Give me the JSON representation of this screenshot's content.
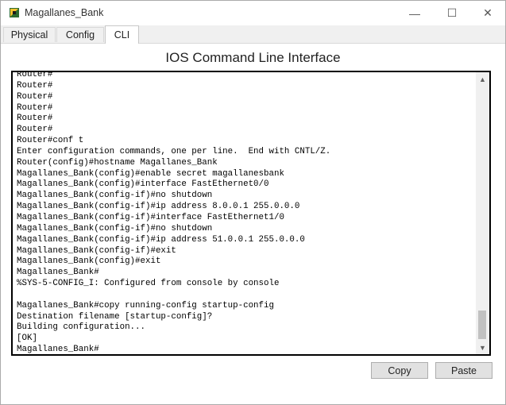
{
  "window": {
    "title": "Magallanes_Bank",
    "controls": {
      "minimize": "—",
      "maximize": "☐",
      "close": "✕"
    }
  },
  "tabs": [
    {
      "label": "Physical",
      "active": false
    },
    {
      "label": "Config",
      "active": false
    },
    {
      "label": "CLI",
      "active": true
    }
  ],
  "cli": {
    "heading": "IOS Command Line Interface",
    "lines": [
      "Router#",
      "Router#",
      "Router#",
      "Router#",
      "Router#",
      "Router#",
      "Router#conf t",
      "Enter configuration commands, one per line.  End with CNTL/Z.",
      "Router(config)#hostname Magallanes_Bank",
      "Magallanes_Bank(config)#enable secret magallanesbank",
      "Magallanes_Bank(config)#interface FastEthernet0/0",
      "Magallanes_Bank(config-if)#no shutdown",
      "Magallanes_Bank(config-if)#ip address 8.0.0.1 255.0.0.0",
      "Magallanes_Bank(config-if)#interface FastEthernet1/0",
      "Magallanes_Bank(config-if)#no shutdown",
      "Magallanes_Bank(config-if)#ip address 51.0.0.1 255.0.0.0",
      "Magallanes_Bank(config-if)#exit",
      "Magallanes_Bank(config)#exit",
      "Magallanes_Bank#",
      "%SYS-5-CONFIG_I: Configured from console by console",
      "",
      "Magallanes_Bank#copy running-config startup-config",
      "Destination filename [startup-config]?",
      "Building configuration...",
      "[OK]",
      "Magallanes_Bank#"
    ],
    "scroll": {
      "up_icon": "▲",
      "down_icon": "▼",
      "position": 0.95
    }
  },
  "buttons": {
    "copy": "Copy",
    "paste": "Paste"
  },
  "colors": {
    "terminal_border": "#000000",
    "background": "#f0f0f0"
  }
}
